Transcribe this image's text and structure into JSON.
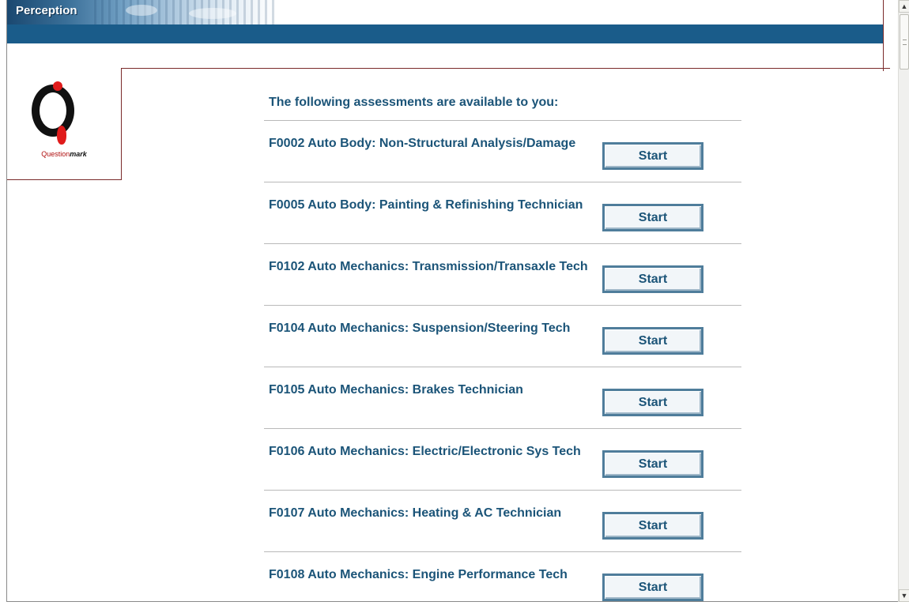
{
  "header": {
    "app_title": "Perception"
  },
  "logo": {
    "text_plain": "Question",
    "text_bold": "mark"
  },
  "list": {
    "title": "The following assessments are available to you:",
    "start_label": "Start",
    "items": [
      {
        "label": "F0002 Auto Body: Non-Structural Analysis/Damage"
      },
      {
        "label": "F0005 Auto Body: Painting & Refinishing Technician"
      },
      {
        "label": "F0102 Auto Mechanics: Transmission/Transaxle Tech"
      },
      {
        "label": "F0104 Auto Mechanics: Suspension/Steering Tech"
      },
      {
        "label": "F0105 Auto Mechanics: Brakes Technician"
      },
      {
        "label": "F0106 Auto Mechanics: Electric/Electronic Sys Tech"
      },
      {
        "label": "F0107 Auto Mechanics: Heating & AC Technician"
      },
      {
        "label": "F0108 Auto Mechanics: Engine Performance Tech"
      }
    ]
  },
  "colors": {
    "header_bar": "#1a5c8a",
    "text_primary": "#1b5478",
    "accent_red": "#e01b1b",
    "divider": "#b9b9b9"
  },
  "icons": {
    "scroll_up": "chevron-up-icon",
    "scroll_down": "chevron-down-icon",
    "logo": "questionmark-logo-icon"
  }
}
